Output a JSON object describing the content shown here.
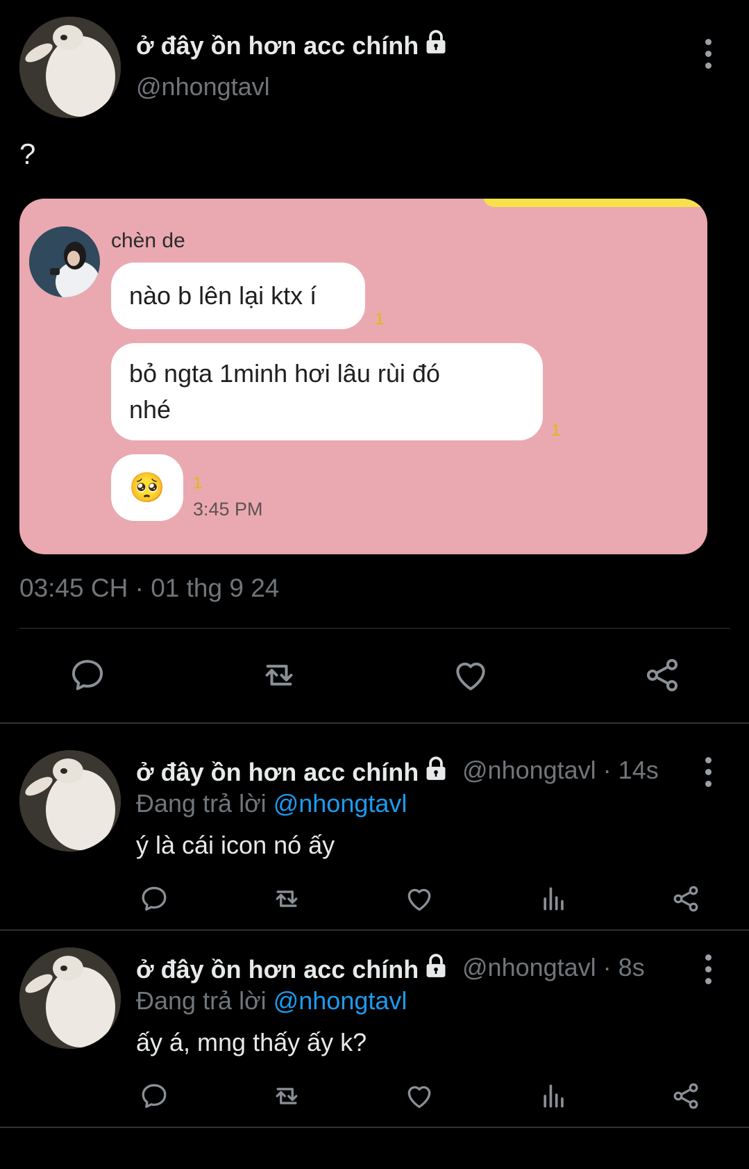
{
  "main_tweet": {
    "display_name": "ở đây ồn hơn acc chính",
    "handle": "@nhongtavl",
    "text": "?",
    "timestamp": "03:45 CH · 01 thg 9 24",
    "embedded_chat": {
      "sender": "chèn de",
      "messages": [
        {
          "text": "nào b lên lại ktx í",
          "read_count": "1"
        },
        {
          "text_line1": "bỏ ngta 1minh hơi lâu rùi đó",
          "text_line2": "nhé",
          "read_count": "1"
        },
        {
          "emoji": "🥺",
          "read_count": "1",
          "time": "3:45 PM"
        }
      ]
    }
  },
  "replies": [
    {
      "display_name": "ở đây ồn hơn acc chính",
      "handle_time": "@nhongtavl · 14s",
      "replying_label": "Đang trả lời",
      "replying_to": "@nhongtavl",
      "text": "ý là cái icon nó ấy"
    },
    {
      "display_name": "ở đây ồn hơn acc chính",
      "handle_time": "@nhongtavl · 8s",
      "replying_label": "Đang trả lời",
      "replying_to": "@nhongtavl",
      "text": "ấy á, mng thấy ấy k?"
    }
  ],
  "icons": {
    "lock": "lock-icon",
    "more": "more-vertical-icon",
    "reply": "reply-icon",
    "retweet": "retweet-icon",
    "like": "heart-icon",
    "views": "views-icon",
    "share": "share-icon"
  },
  "colors": {
    "background": "#000000",
    "text": "#e7e9ea",
    "muted": "#71767b",
    "link": "#1d9bf0",
    "chat_background": "#eaa9b1",
    "read_count": "#e6b800"
  }
}
